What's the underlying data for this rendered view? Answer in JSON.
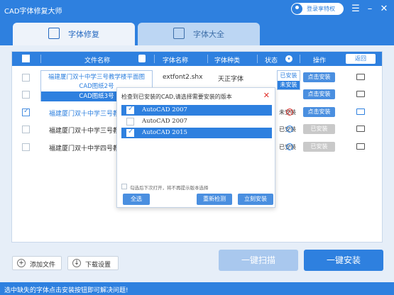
{
  "app": {
    "title": "CAD字体修复大师",
    "login_label": "登录享特权"
  },
  "tabs": [
    {
      "label": "字体修复",
      "active": true
    },
    {
      "label": "字体大全",
      "active": false
    }
  ],
  "table": {
    "headers": [
      "文件名称",
      "字体名称",
      "字体种类",
      "状态",
      "操作"
    ],
    "back_label": "返回",
    "rows": [
      {
        "name": "福建厦门双十中学三号教学楼平面图",
        "font": "extfont2.shx",
        "type": "天正字体",
        "status": "已安装",
        "action": "点击安装",
        "checked": false,
        "name_color": "#2e80df"
      },
      {
        "name": "CAD图纸2号",
        "font": "",
        "type": "",
        "status": "未安装",
        "action": "点击安装",
        "checked": false,
        "name_color": "#2e80df"
      },
      {
        "name": "福建厦门双十中学三号教学",
        "font": "",
        "type": "",
        "status": "未安装",
        "action": "点击安装",
        "checked": true,
        "name_color": "#2e80df"
      },
      {
        "name": "福建厦门双十中学三号教学",
        "font": "",
        "type": "",
        "status": "已安装",
        "action": "已安装",
        "checked": false,
        "name_color": "#333333"
      },
      {
        "name": "福建厦门双十中学四号教学",
        "font": "",
        "type": "",
        "status": "已安装",
        "action": "已安装",
        "checked": false,
        "name_color": "#333333"
      }
    ],
    "name_dropdown": [
      "福建厦门双十中学三号教学楼平面图",
      "CAD图纸2号",
      "CAD图纸3号"
    ],
    "status_dropdown": [
      "已安装",
      "未安装"
    ]
  },
  "dialog": {
    "title": "检查到已安装的CAD,请选择需要安装的版本",
    "options": [
      {
        "label": "AutoCAD 2007",
        "checked": true,
        "selected": true
      },
      {
        "label": "AutoCAD 2007",
        "checked": false,
        "selected": false
      },
      {
        "label": "AutoCAD 2015",
        "checked": true,
        "selected": true
      }
    ],
    "note": "勾选后下次打开，将不再提示版本选择",
    "select_all": "全选",
    "recheck": "重新检测",
    "install_now": "立刻安装"
  },
  "footer": {
    "add_file": "添加文件",
    "download_settings": "下载设置",
    "scan": "一键扫描",
    "install_all": "一键安装"
  },
  "status_text": "选中缺失的字体点击安装按钮即可解决问题!",
  "colors": {
    "primary": "#2e80df",
    "scan_disabled": "#a9c8ee",
    "error": "#e0302a"
  }
}
